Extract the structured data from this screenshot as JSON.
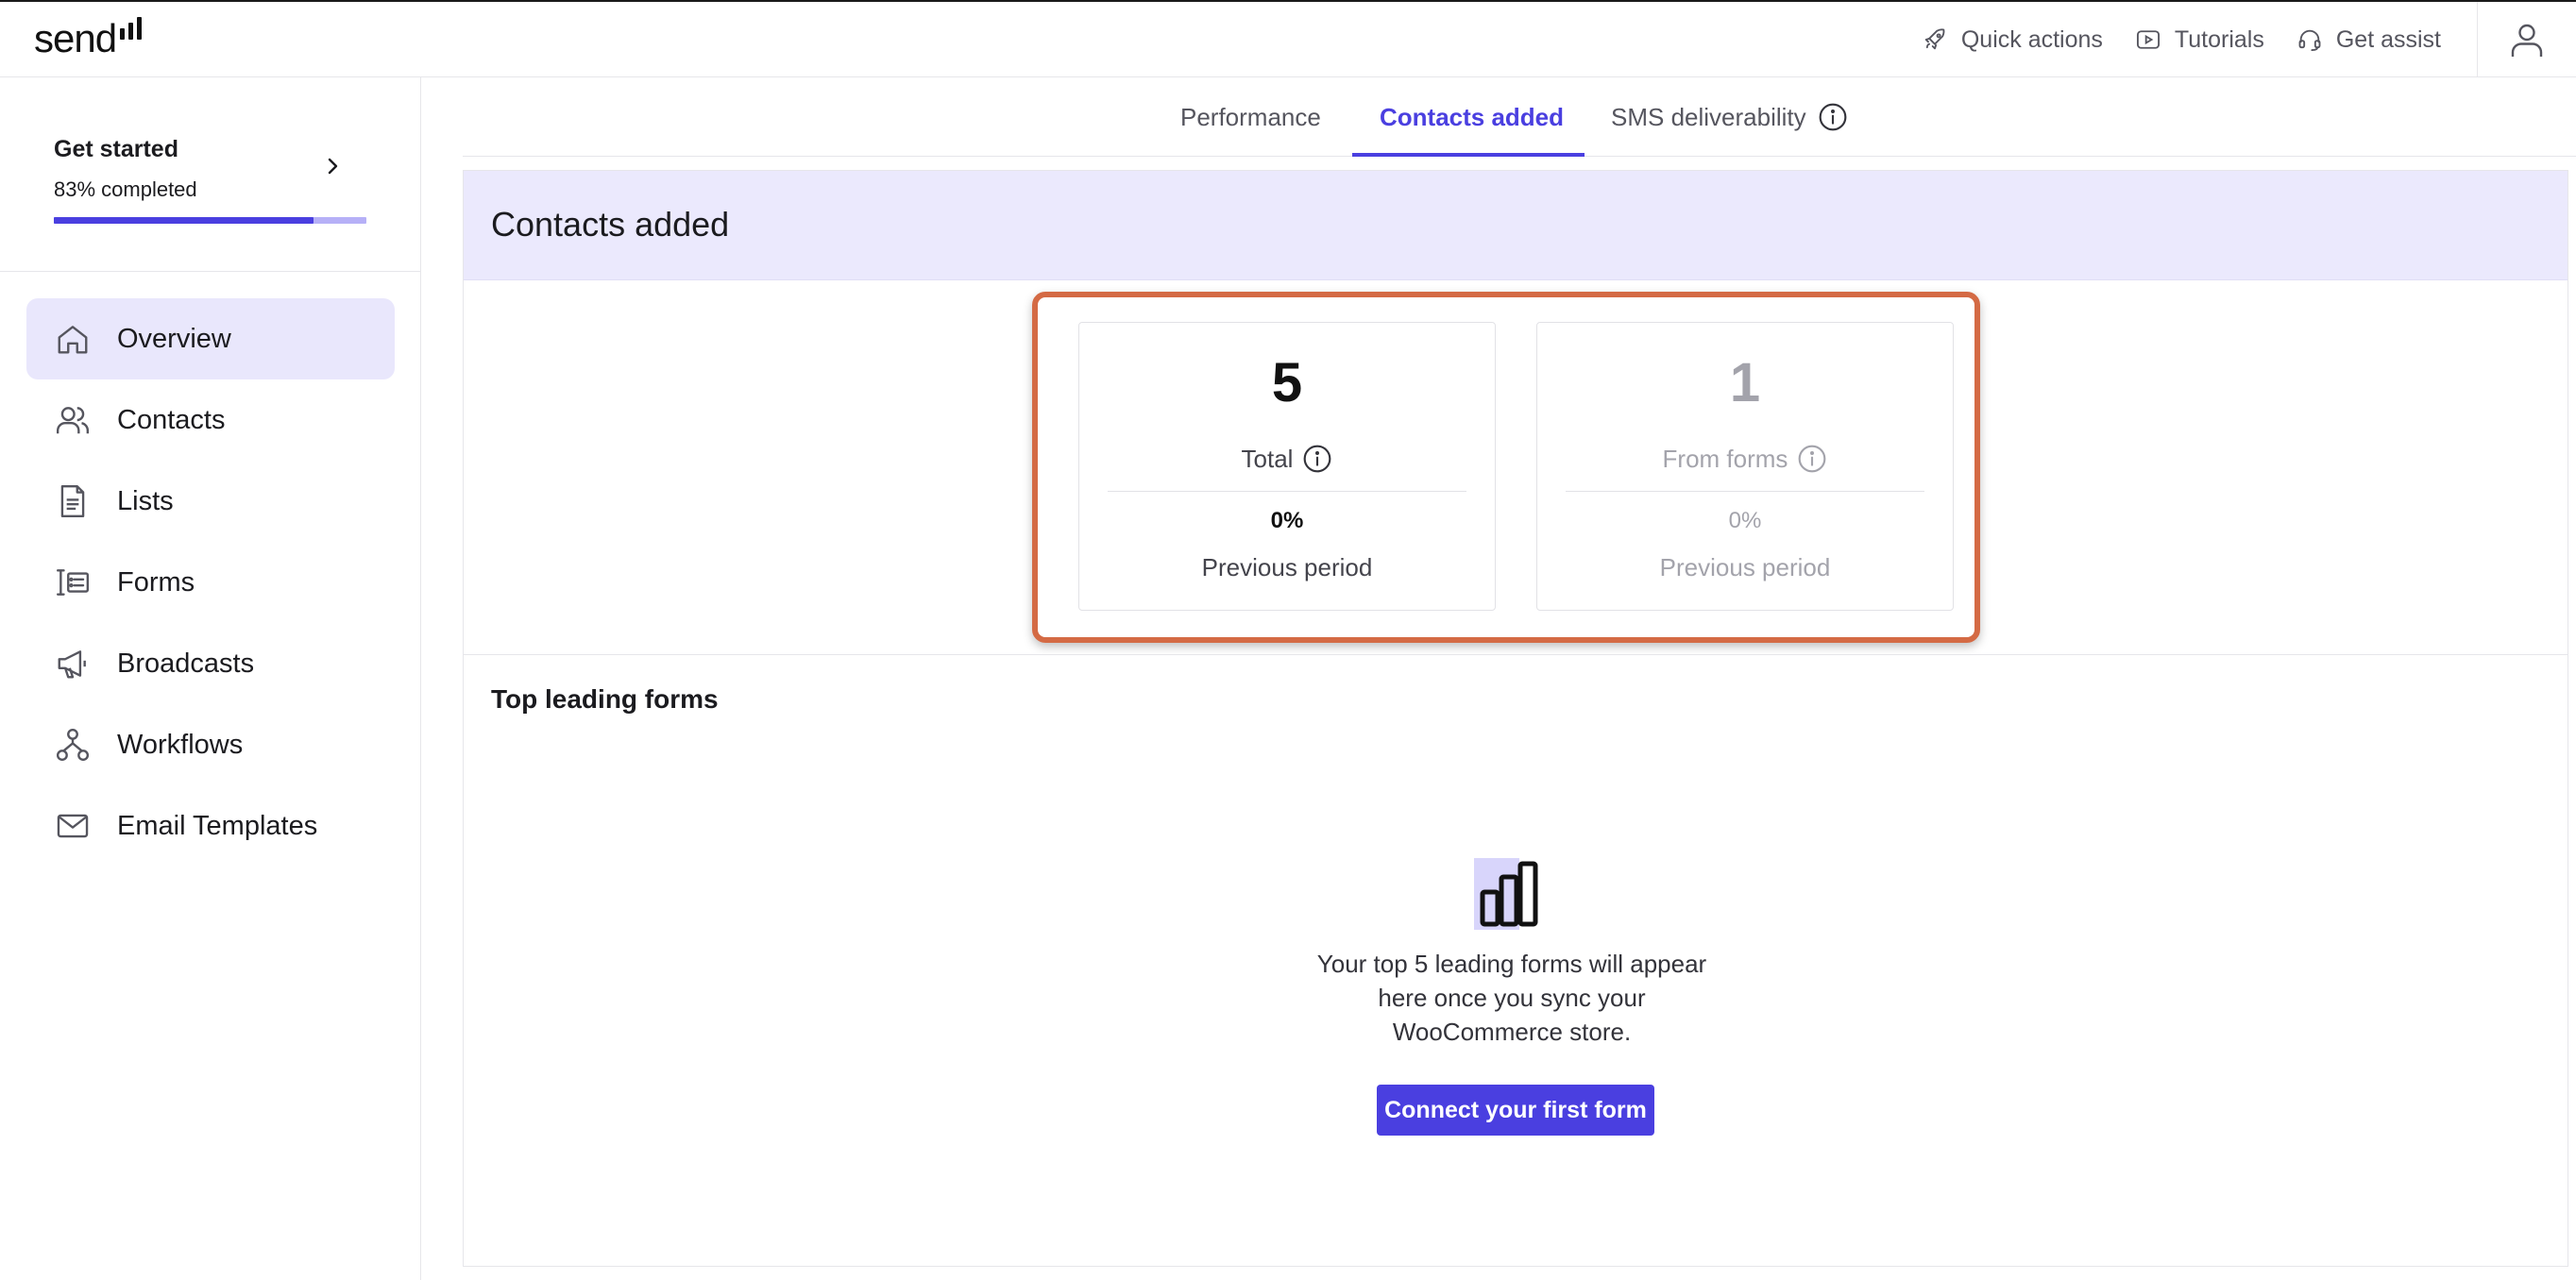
{
  "brand": {
    "logo_text": "send"
  },
  "topbar": {
    "actions": [
      {
        "label": "Quick actions",
        "icon": "rocket-icon"
      },
      {
        "label": "Tutorials",
        "icon": "play-icon"
      },
      {
        "label": "Get assist",
        "icon": "headset-icon"
      }
    ],
    "user_icon": "user-icon"
  },
  "sidebar": {
    "get_started": {
      "title": "Get started",
      "progress_text": "83% completed",
      "progress": 0.83
    },
    "items": [
      {
        "label": "Overview",
        "icon": "home-icon",
        "active": true
      },
      {
        "label": "Contacts",
        "icon": "contacts-icon"
      },
      {
        "label": "Lists",
        "icon": "document-icon"
      },
      {
        "label": "Forms",
        "icon": "form-icon"
      },
      {
        "label": "Broadcasts",
        "icon": "megaphone-icon"
      },
      {
        "label": "Workflows",
        "icon": "workflow-icon"
      },
      {
        "label": "Email Templates",
        "icon": "mail-icon"
      }
    ]
  },
  "tabs": [
    {
      "label": "Performance"
    },
    {
      "label": "Contacts added",
      "active": true
    },
    {
      "label": "SMS deliverability",
      "icon": "info-icon"
    }
  ],
  "panel": {
    "title": "Contacts added",
    "stats": [
      {
        "value": "5",
        "label": "Total",
        "pct": "0%",
        "sub": "Previous period"
      },
      {
        "value": "1",
        "label": "From forms",
        "pct": "0%",
        "sub": "Previous period"
      }
    ],
    "highlight_color": "#d46a44"
  },
  "top_forms": {
    "title": "Top leading forms",
    "empty_icon": "bar-chart-icon",
    "empty_text": "Your top 5 leading forms will appear here once you sync your WooCommerce store.",
    "cta_label": "Connect your first form"
  },
  "colors": {
    "accent": "#4a3fe0",
    "accent_light": "#ebe9fd"
  }
}
